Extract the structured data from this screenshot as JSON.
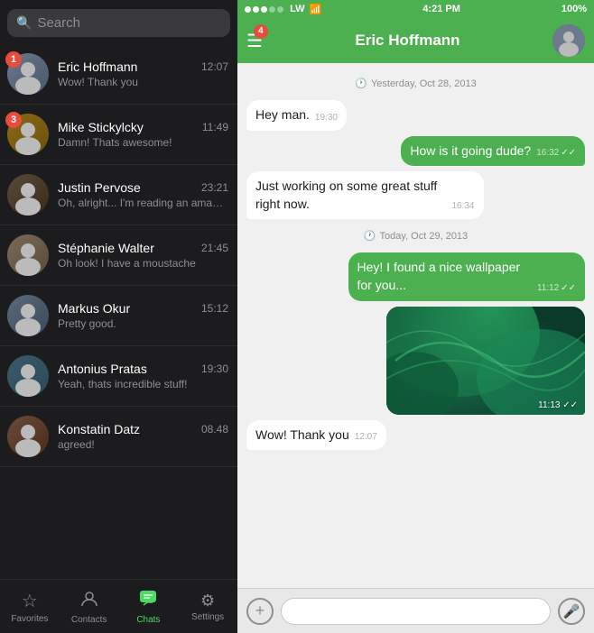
{
  "statusBar": {
    "carrier": "LW",
    "time": "4:21 PM",
    "battery": "100%",
    "signal": [
      true,
      true,
      true,
      false,
      false
    ]
  },
  "header": {
    "title": "Eric Hoffmann",
    "badgeCount": "4",
    "menuIcon": "☰"
  },
  "search": {
    "placeholder": "Search"
  },
  "chats": [
    {
      "id": 1,
      "name": "Eric Hoffmann",
      "time": "12:07",
      "preview": "Wow! Thank you",
      "badge": "1",
      "avatarClass": "av-eric"
    },
    {
      "id": 2,
      "name": "Mike Stickylcky",
      "time": "11:49",
      "preview": "Damn! Thats awesome!",
      "badge": "3",
      "avatarClass": "av-mike"
    },
    {
      "id": 3,
      "name": "Justin Pervose",
      "time": "23:21",
      "preview": "Oh, alright... I'm reading an amazing article at...",
      "badge": null,
      "avatarClass": "av-justin"
    },
    {
      "id": 4,
      "name": "Stéphanie Walter",
      "time": "21:45",
      "preview": "Oh look! I have a moustache",
      "badge": null,
      "avatarClass": "av-stephanie"
    },
    {
      "id": 5,
      "name": "Markus Okur",
      "time": "15:12",
      "preview": "Pretty good.",
      "badge": null,
      "avatarClass": "av-markus"
    },
    {
      "id": 6,
      "name": "Antonius Pratas",
      "time": "19:30",
      "preview": "Yeah, thats incredible stuff!",
      "badge": null,
      "avatarClass": "av-antonius"
    },
    {
      "id": 7,
      "name": "Konstatin Datz",
      "time": "08.48",
      "preview": "agreed!",
      "badge": null,
      "avatarClass": "av-konstatin"
    }
  ],
  "messages": [
    {
      "id": 1,
      "type": "date",
      "text": "Yesterday, Oct 28, 2013"
    },
    {
      "id": 2,
      "type": "incoming",
      "text": "Hey man.",
      "time": "19:30"
    },
    {
      "id": 3,
      "type": "outgoing",
      "text": "How is it going dude?",
      "time": "16:32",
      "ticks": "✓✓"
    },
    {
      "id": 4,
      "type": "incoming",
      "text": "Just working on some great stuff right now.",
      "time": "16:34"
    },
    {
      "id": 5,
      "type": "date",
      "text": "Today, Oct 29, 2013"
    },
    {
      "id": 6,
      "type": "outgoing",
      "text": "Hey! I found a nice wallpaper for you...",
      "time": "11:12",
      "ticks": "✓✓"
    },
    {
      "id": 7,
      "type": "image",
      "time": "11:13",
      "ticks": "✓✓"
    },
    {
      "id": 8,
      "type": "incoming",
      "text": "Wow! Thank you",
      "time": "12:07"
    }
  ],
  "tabs": [
    {
      "id": "favorites",
      "label": "Favorites",
      "icon": "☆",
      "active": false
    },
    {
      "id": "contacts",
      "label": "Contacts",
      "icon": "👤",
      "active": false
    },
    {
      "id": "chats",
      "label": "Chats",
      "icon": "💬",
      "active": true
    },
    {
      "id": "settings",
      "label": "Settings",
      "icon": "⚙",
      "active": false
    }
  ],
  "inputBar": {
    "placeholder": ""
  }
}
